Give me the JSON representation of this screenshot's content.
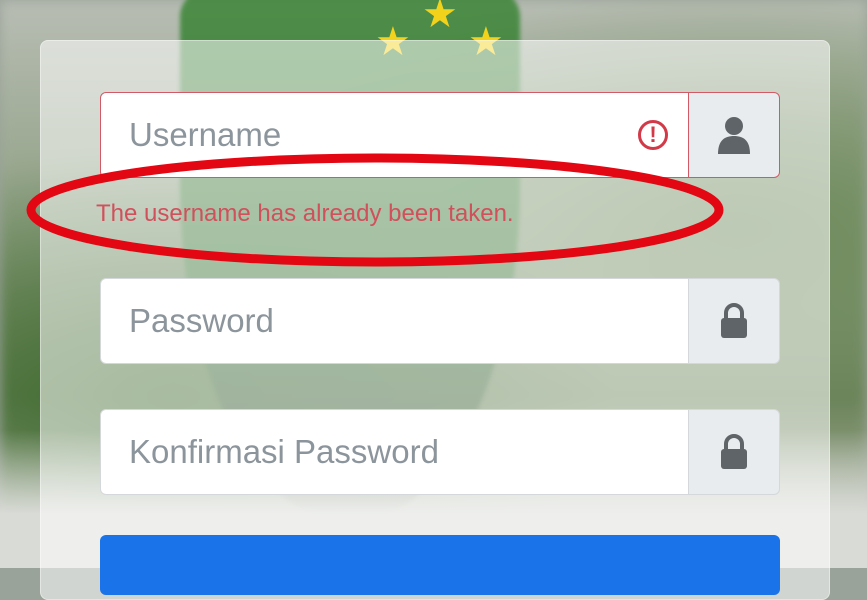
{
  "form": {
    "username": {
      "placeholder": "Username",
      "error": "The username has already been taken."
    },
    "password": {
      "placeholder": "Password"
    },
    "confirm_password": {
      "placeholder": "Konfirmasi Password"
    },
    "submit_label": ""
  },
  "icons": {
    "username_addon": "user-icon",
    "password_addon": "lock-icon",
    "confirm_addon": "lock-icon",
    "error_indicator": "exclamation-circle-icon"
  },
  "annotation": {
    "color": "#e30613"
  },
  "colors": {
    "error": "#d0505c",
    "primary": "#1a73e8"
  }
}
